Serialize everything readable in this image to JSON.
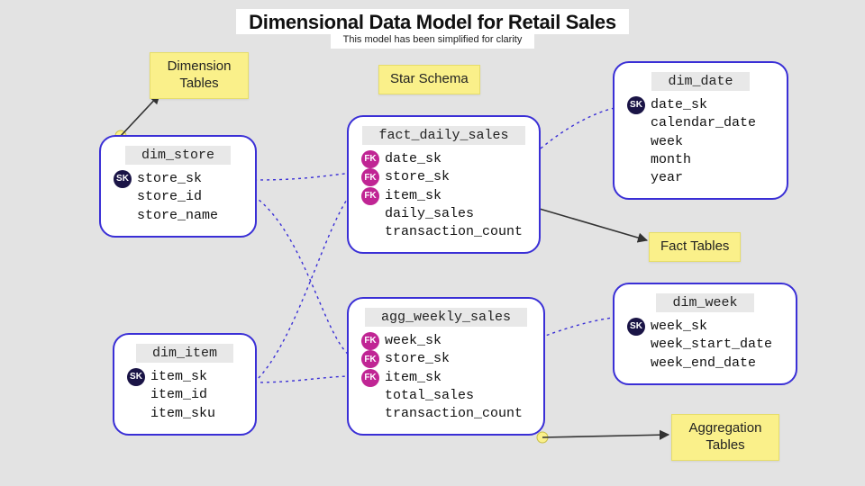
{
  "header": {
    "title": "Dimensional Data Model for Retail Sales",
    "subtitle": "This model has been simplified for clarity"
  },
  "stickies": {
    "dimension": {
      "line1": "Dimension",
      "line2": "Tables"
    },
    "star": "Star Schema",
    "fact": "Fact Tables",
    "agg": {
      "line1": "Aggregation",
      "line2": "Tables"
    }
  },
  "badges": {
    "sk": "SK",
    "fk": "FK"
  },
  "tables": {
    "dim_store": {
      "name": "dim_store",
      "cols": [
        {
          "key": "sk",
          "label": "store_sk"
        },
        {
          "key": "",
          "label": "store_id"
        },
        {
          "key": "",
          "label": "store_name"
        }
      ]
    },
    "dim_item": {
      "name": "dim_item",
      "cols": [
        {
          "key": "sk",
          "label": "item_sk"
        },
        {
          "key": "",
          "label": "item_id"
        },
        {
          "key": "",
          "label": "item_sku"
        }
      ]
    },
    "dim_date": {
      "name": "dim_date",
      "cols": [
        {
          "key": "sk",
          "label": "date_sk"
        },
        {
          "key": "",
          "label": "calendar_date"
        },
        {
          "key": "",
          "label": "week"
        },
        {
          "key": "",
          "label": "month"
        },
        {
          "key": "",
          "label": "year"
        }
      ]
    },
    "dim_week": {
      "name": "dim_week",
      "cols": [
        {
          "key": "sk",
          "label": "week_sk"
        },
        {
          "key": "",
          "label": "week_start_date"
        },
        {
          "key": "",
          "label": "week_end_date"
        }
      ]
    },
    "fact_daily_sales": {
      "name": "fact_daily_sales",
      "cols": [
        {
          "key": "fk",
          "label": "date_sk"
        },
        {
          "key": "fk",
          "label": "store_sk"
        },
        {
          "key": "fk",
          "label": "item_sk"
        },
        {
          "key": "",
          "label": "daily_sales"
        },
        {
          "key": "",
          "label": "transaction_count"
        }
      ]
    },
    "agg_weekly_sales": {
      "name": "agg_weekly_sales",
      "cols": [
        {
          "key": "fk",
          "label": "week_sk"
        },
        {
          "key": "fk",
          "label": "store_sk"
        },
        {
          "key": "fk",
          "label": "item_sk"
        },
        {
          "key": "",
          "label": "total_sales"
        },
        {
          "key": "",
          "label": "transaction_count"
        }
      ]
    }
  }
}
